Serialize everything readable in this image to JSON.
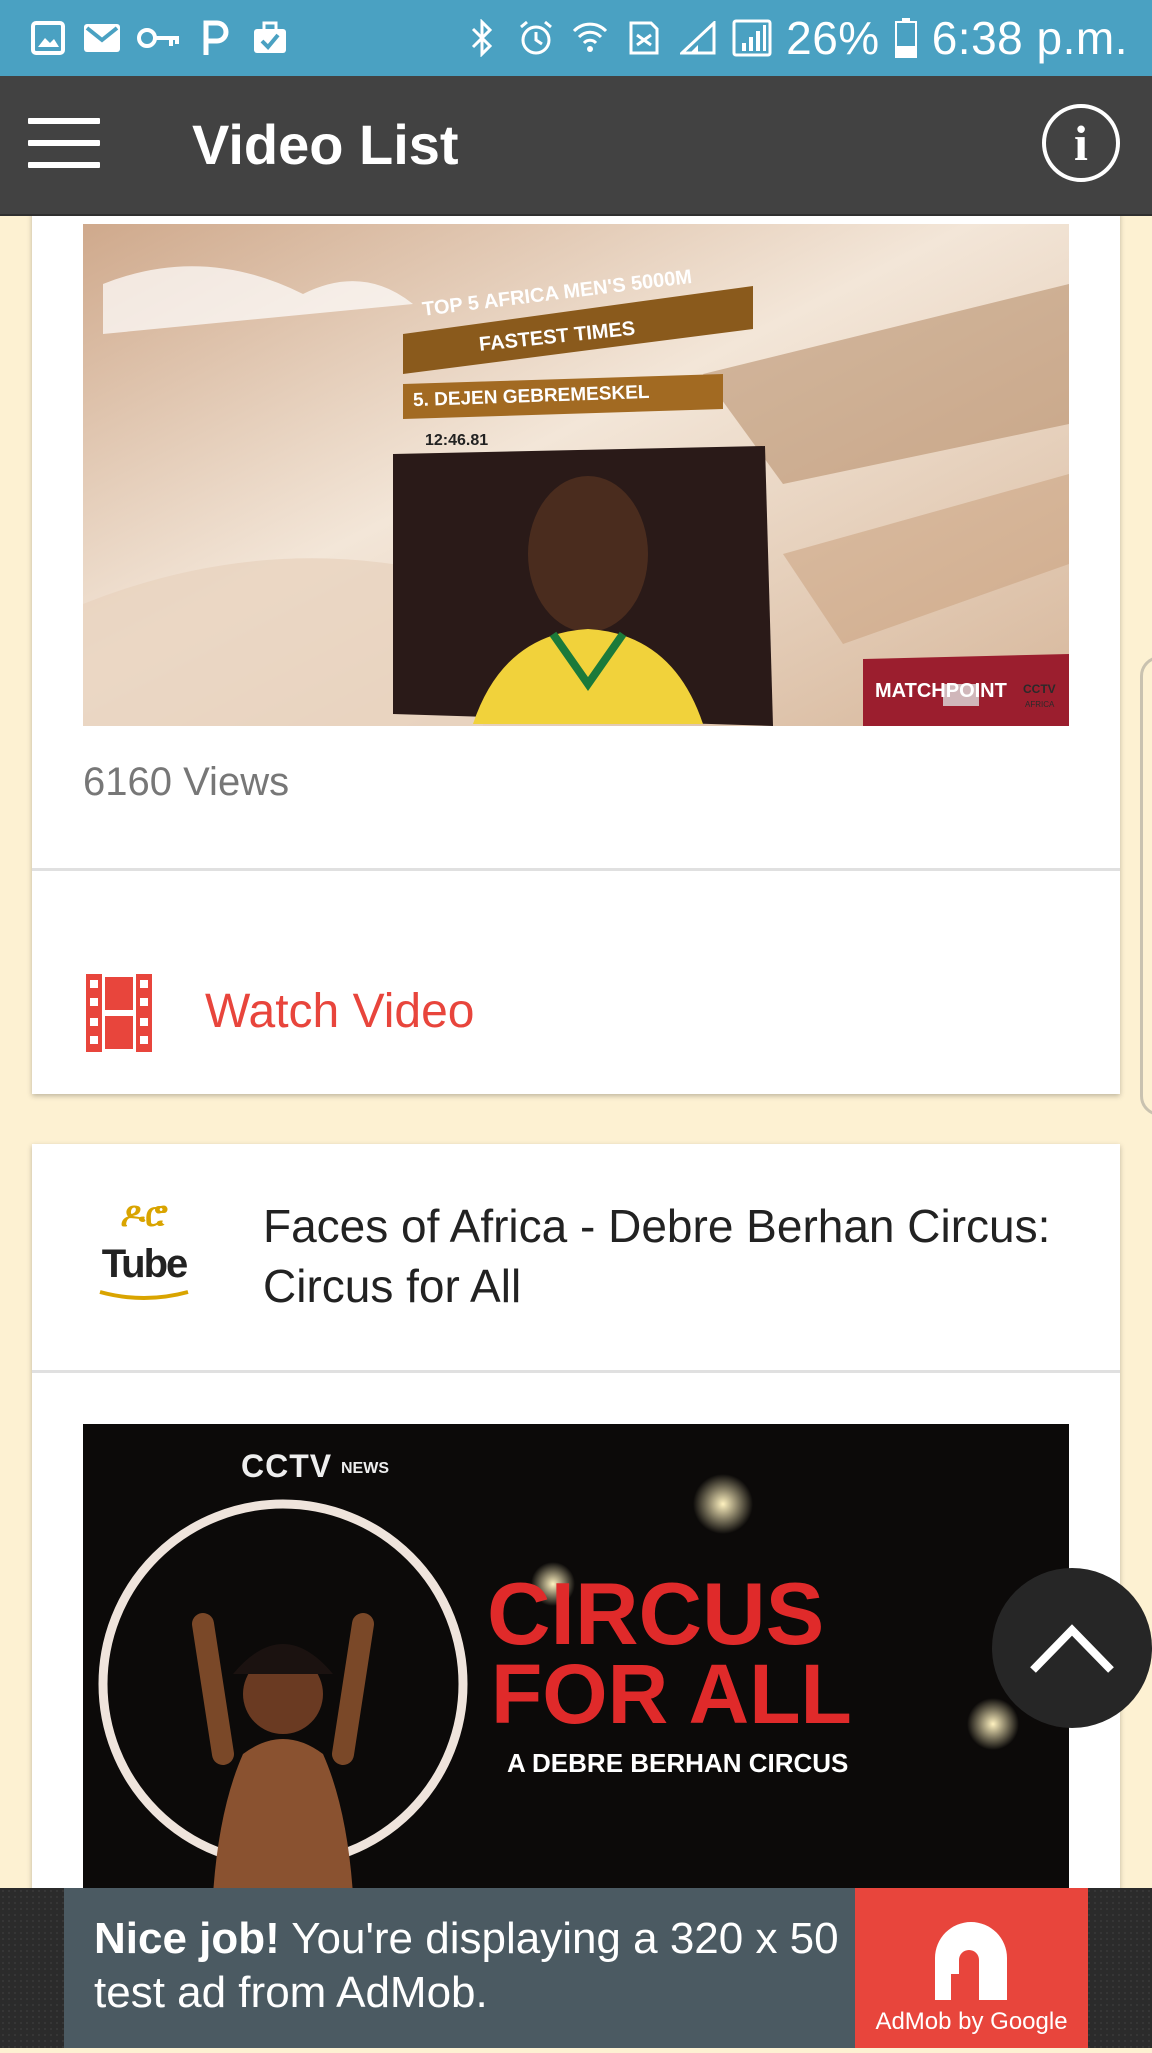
{
  "status_bar": {
    "battery_percent": "26%",
    "time": "6:38 p.m.",
    "left_icons": [
      "image-icon",
      "gmail-icon",
      "key-icon",
      "p-icon",
      "briefcase-check-icon"
    ],
    "right_icons": [
      "bluetooth-icon",
      "alarm-icon",
      "wifi-icon",
      "sim-icon",
      "signal-icon",
      "signal-icon",
      "battery-icon"
    ]
  },
  "app_bar": {
    "title": "Video List",
    "info_label": "i"
  },
  "cards": [
    {
      "thumbnail": {
        "banner_line1": "TOP 5 AFRICA MEN'S 5000M",
        "banner_line2": "FASTEST TIMES",
        "athlete": "5. DEJEN GEBREMESKEL",
        "time": "12:46.81",
        "badge": "MATCHPOINT",
        "badge_logo": "CCTV",
        "badge_sub": "AFRICA"
      },
      "views": "6160 Views",
      "action_label": "Watch Video"
    },
    {
      "channel_logo_top": "ዶሮ",
      "channel_logo_bottom": "Tube",
      "title": "Faces of Africa - Debre Berhan Circus: Circus for All",
      "thumbnail": {
        "network": "CCTV",
        "network_sub": "NEWS",
        "headline1": "CIRCUS",
        "headline2": "FOR ALL",
        "subhead": "A DEBRE BERHAN CIRCUS"
      }
    }
  ],
  "ad": {
    "bold": "Nice job!",
    "text": " You're displaying a 320 x 50 test ad from AdMob.",
    "brand": "AdMob by Google"
  },
  "colors": {
    "status_bar": "#4aa1c2",
    "app_bar": "#424242",
    "background": "#fdf1d2",
    "accent": "#e8453c"
  }
}
